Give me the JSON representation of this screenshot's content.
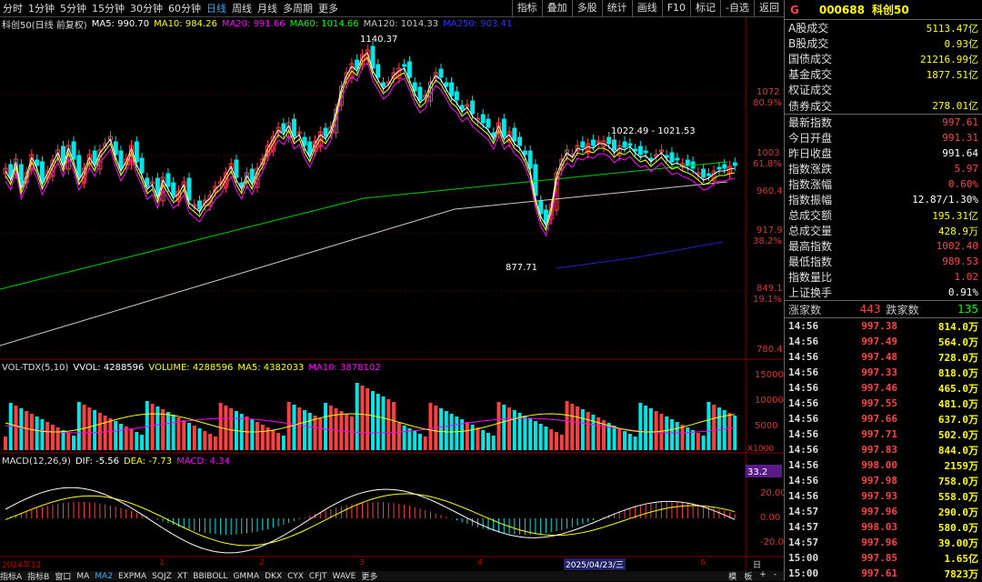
{
  "toolbar": {
    "periods": [
      "分时",
      "1分钟",
      "5分钟",
      "15分钟",
      "30分钟",
      "60分钟",
      "日线",
      "周线",
      "月线",
      "多周期",
      "更多"
    ],
    "active_period": "日线",
    "right_buttons": [
      "指标",
      "叠加",
      "多股",
      "统计",
      "画线",
      "F10",
      "标记",
      "-自选",
      "返回"
    ]
  },
  "ma_line": {
    "name": "科创50(日线 前复权)",
    "items": [
      {
        "label": "MA5: 990.70",
        "color": "#ffffff"
      },
      {
        "label": "MA10: 984.26",
        "color": "#ffff00"
      },
      {
        "label": "MA20: 991.66",
        "color": "#ff00ff"
      },
      {
        "label": "MA60: 1014.66",
        "color": "#00ff00"
      },
      {
        "label": "MA120: 1014.33",
        "color": "#c8c8c8"
      },
      {
        "label": "MA250: 903.41",
        "color": "#3333ff"
      }
    ]
  },
  "price_axis": {
    "labels": [
      {
        "text": "1072",
        "pct": "80.9%"
      },
      {
        "text": "1003",
        "pct": "61.8%"
      },
      {
        "text": "960.4",
        "pct": ""
      },
      {
        "text": "917.9",
        "pct": "38.2%"
      },
      {
        "text": "849.1",
        "pct": "19.1%"
      },
      {
        "text": "780.4",
        "pct": ""
      }
    ]
  },
  "annotations": {
    "high": "1140.37",
    "low": "877.71",
    "range": "1022.49 - 1021.53"
  },
  "volume": {
    "title": "VOL-TDX(5,10)",
    "items": [
      {
        "label": "VVOL: 4288596",
        "color": "#ffffff"
      },
      {
        "label": "VOLUME: 4288596",
        "color": "#ffff00"
      },
      {
        "label": "MA5: 4382033",
        "color": "#ffff00"
      },
      {
        "label": "MA10: 3878102",
        "color": "#ff00ff"
      }
    ],
    "axis": [
      "15000",
      "10000",
      "5000"
    ],
    "unit": "X1000"
  },
  "macd": {
    "title": "MACD(12,26,9)",
    "items": [
      {
        "label": "DIF: -5.56",
        "color": "#ffffff"
      },
      {
        "label": "DEA: -7.73",
        "color": "#ffff00"
      },
      {
        "label": "MACD: 4.34",
        "color": "#ff00ff"
      }
    ],
    "axis": [
      "33.2",
      "20.00",
      "0.00",
      "-20.00"
    ]
  },
  "date_axis": {
    "labels": [
      "2024年12",
      "1",
      "2",
      "3",
      "4",
      "2025/04/23/三",
      "6"
    ],
    "corner": "日线"
  },
  "bottom_tabs": [
    "指标A",
    "指标B",
    "窗口",
    "MA",
    "MA2",
    "EXPMA",
    "SQJZ",
    "XT",
    "BBIBOLL",
    "GMMA",
    "DKX",
    "CYX",
    "CFJT",
    "WAVE",
    "更多"
  ],
  "bottom_right": [
    "模",
    "板",
    "+",
    "-"
  ],
  "panel": {
    "flag": "G",
    "code": "000688",
    "name": "科创50",
    "stats": [
      {
        "label": "A股成交",
        "value": "5113.47亿",
        "color": "#ffff00"
      },
      {
        "label": "B股成交",
        "value": "0.93亿",
        "color": "#ffff00"
      },
      {
        "label": "国债成交",
        "value": "21216.99亿",
        "color": "#ffff00"
      },
      {
        "label": "基金成交",
        "value": "1877.51亿",
        "color": "#ffff00"
      },
      {
        "label": "权证成交",
        "value": "",
        "color": "#ffff00"
      },
      {
        "label": "债券成交",
        "value": "278.01亿",
        "color": "#ffff00"
      },
      {
        "label": "最新指数",
        "value": "997.61",
        "color": "#ff4444"
      },
      {
        "label": "今日开盘",
        "value": "991.31",
        "color": "#ff4444"
      },
      {
        "label": "昨日收盘",
        "value": "991.64",
        "color": "#ffffff"
      },
      {
        "label": "指数涨跌",
        "value": "5.97",
        "color": "#ff4444"
      },
      {
        "label": "指数涨幅",
        "value": "0.60%",
        "color": "#ff4444"
      },
      {
        "label": "指数振幅",
        "value": "12.87/1.30%",
        "color": "#ffffff"
      },
      {
        "label": "总成交额",
        "value": "195.31亿",
        "color": "#ffff00"
      },
      {
        "label": "总成交量",
        "value": "428.9万",
        "color": "#ffff00"
      },
      {
        "label": "最高指数",
        "value": "1002.40",
        "color": "#ff4444"
      },
      {
        "label": "最低指数",
        "value": "989.53",
        "color": "#ff4444"
      },
      {
        "label": "指数量比",
        "value": "1.02",
        "color": "#ff4444"
      },
      {
        "label": "上证换手",
        "value": "0.91%",
        "color": "#ffffff"
      }
    ],
    "up_label": "涨家数",
    "up_count": "443",
    "down_label": "跌家数",
    "down_count": "135",
    "ticks": [
      [
        "14:56",
        "997.38",
        "814.0万"
      ],
      [
        "14:56",
        "997.49",
        "564.0万"
      ],
      [
        "14:56",
        "997.48",
        "728.0万"
      ],
      [
        "14:56",
        "997.33",
        "818.0万"
      ],
      [
        "14:56",
        "997.46",
        "465.0万"
      ],
      [
        "14:56",
        "997.55",
        "481.0万"
      ],
      [
        "14:56",
        "997.66",
        "637.0万"
      ],
      [
        "14:56",
        "997.71",
        "502.0万"
      ],
      [
        "14:56",
        "997.83",
        "844.0万"
      ],
      [
        "14:56",
        "998.00",
        "2159万"
      ],
      [
        "14:56",
        "997.98",
        "758.0万"
      ],
      [
        "14:56",
        "997.93",
        "558.0万"
      ],
      [
        "14:57",
        "997.96",
        "290.0万"
      ],
      [
        "14:57",
        "998.03",
        "580.0万"
      ],
      [
        "14:57",
        "997.96",
        "39.00万"
      ],
      [
        "15:00",
        "997.85",
        "1.65亿"
      ],
      [
        "15:00",
        "997.61",
        "7823万"
      ]
    ]
  }
}
